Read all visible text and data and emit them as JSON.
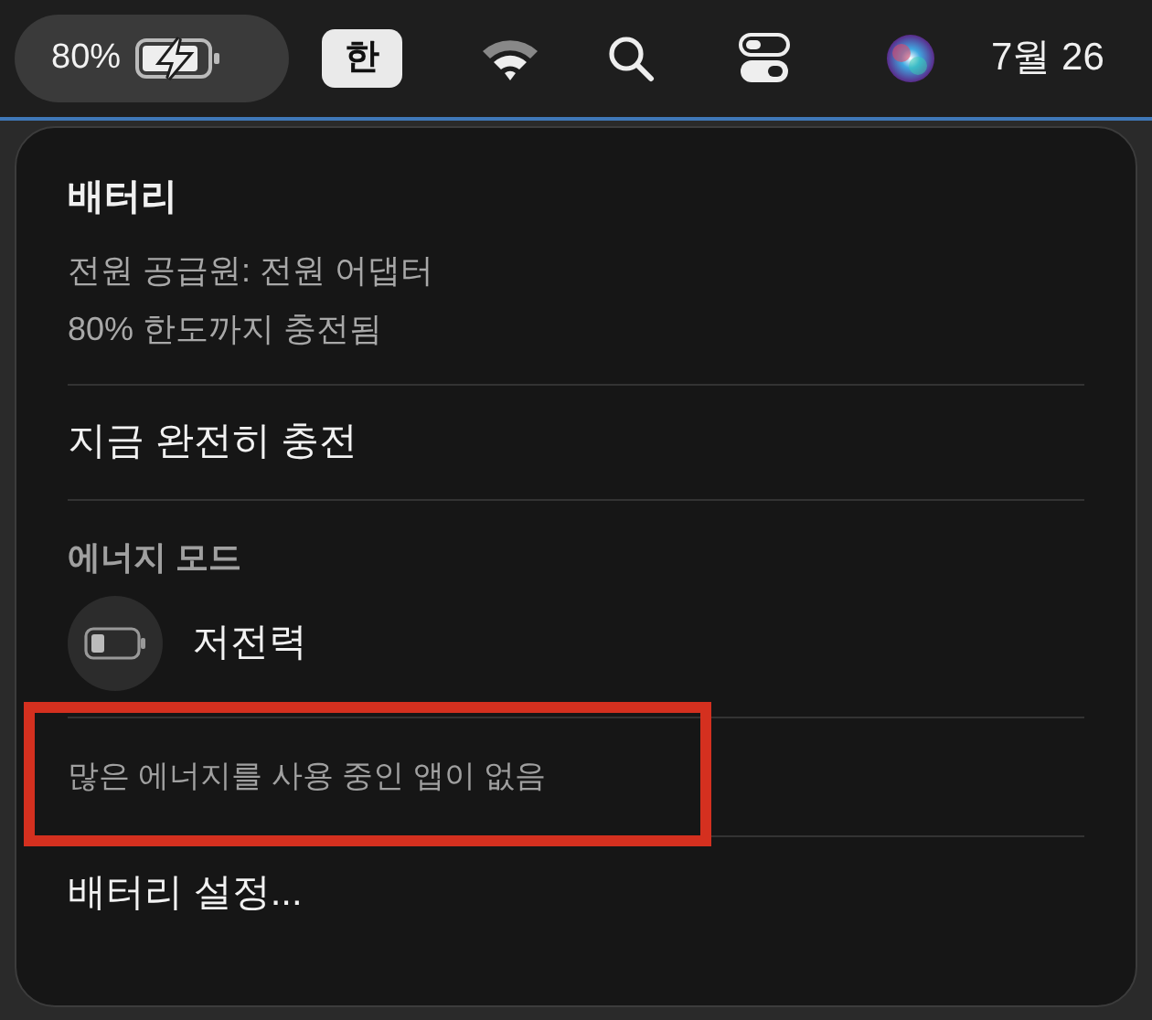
{
  "menu_bar": {
    "battery_percent": "80%",
    "input_source": "한",
    "clock": "7월 26"
  },
  "battery_menu": {
    "title": "배터리",
    "info": [
      {
        "text": "전원 공급원: 전원 어댑터"
      },
      {
        "text": "80% 한도까지 충전됨"
      }
    ],
    "charge_now": "지금 완전히 충전",
    "energy_mode": {
      "heading": "에너지 모드",
      "option": "저전력",
      "on": false
    },
    "apps_note": {
      "text": "많은 에너지를 사용 중인 앱이 없음",
      "highlighted": true
    },
    "settings": "배터리 설정..."
  }
}
